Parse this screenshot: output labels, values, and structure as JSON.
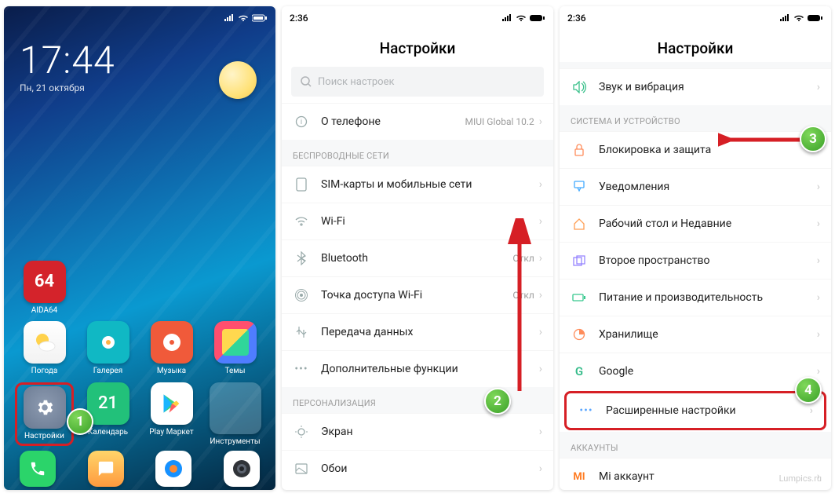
{
  "phone1": {
    "clock_time": "17:44",
    "clock_date": "Пн, 21 октября",
    "app_aida_num": "64",
    "apps": {
      "aida": "AIDA64",
      "weather": "Погода",
      "gallery": "Галерея",
      "music": "Музыка",
      "themes": "Темы",
      "settings": "Настройки",
      "calendar": "Календарь",
      "calendar_day": "21",
      "play": "Play Маркет",
      "tools": "Инструменты"
    },
    "step": "1"
  },
  "phone2": {
    "status_time": "2:36",
    "title": "Настройки",
    "search_placeholder": "Поиск настроек",
    "about_label": "О телефоне",
    "about_value": "MIUI Global 10.2",
    "section_wireless": "Беспроводные сети",
    "sim": "SIM-карты и мобильные сети",
    "wifi": "Wi-Fi",
    "bluetooth": "Bluetooth",
    "bluetooth_state": "Откл",
    "hotspot": "Точка доступа Wi-Fi",
    "hotspot_state": "Откл",
    "data": "Передача данных",
    "more": "Дополнительные функции",
    "section_personalization": "Персонализация",
    "screen": "Экран",
    "wallpaper": "Обои",
    "step": "2"
  },
  "phone3": {
    "status_time": "2:36",
    "title": "Настройки",
    "sound": "Звук и вибрация",
    "section_system": "Система и устройство",
    "lock": "Блокировка и защита",
    "notifications": "Уведомления",
    "desktop": "Рабочий стол и Недавние",
    "second_space": "Второе пространство",
    "battery": "Питание и производительность",
    "storage": "Хранилище",
    "google": "Google",
    "advanced": "Расширенные настройки",
    "section_accounts": "Аккаунты",
    "mi_account": "Mi аккаунт",
    "step_top": "3",
    "step_bottom": "4",
    "watermark": "Lumpics.ru"
  }
}
